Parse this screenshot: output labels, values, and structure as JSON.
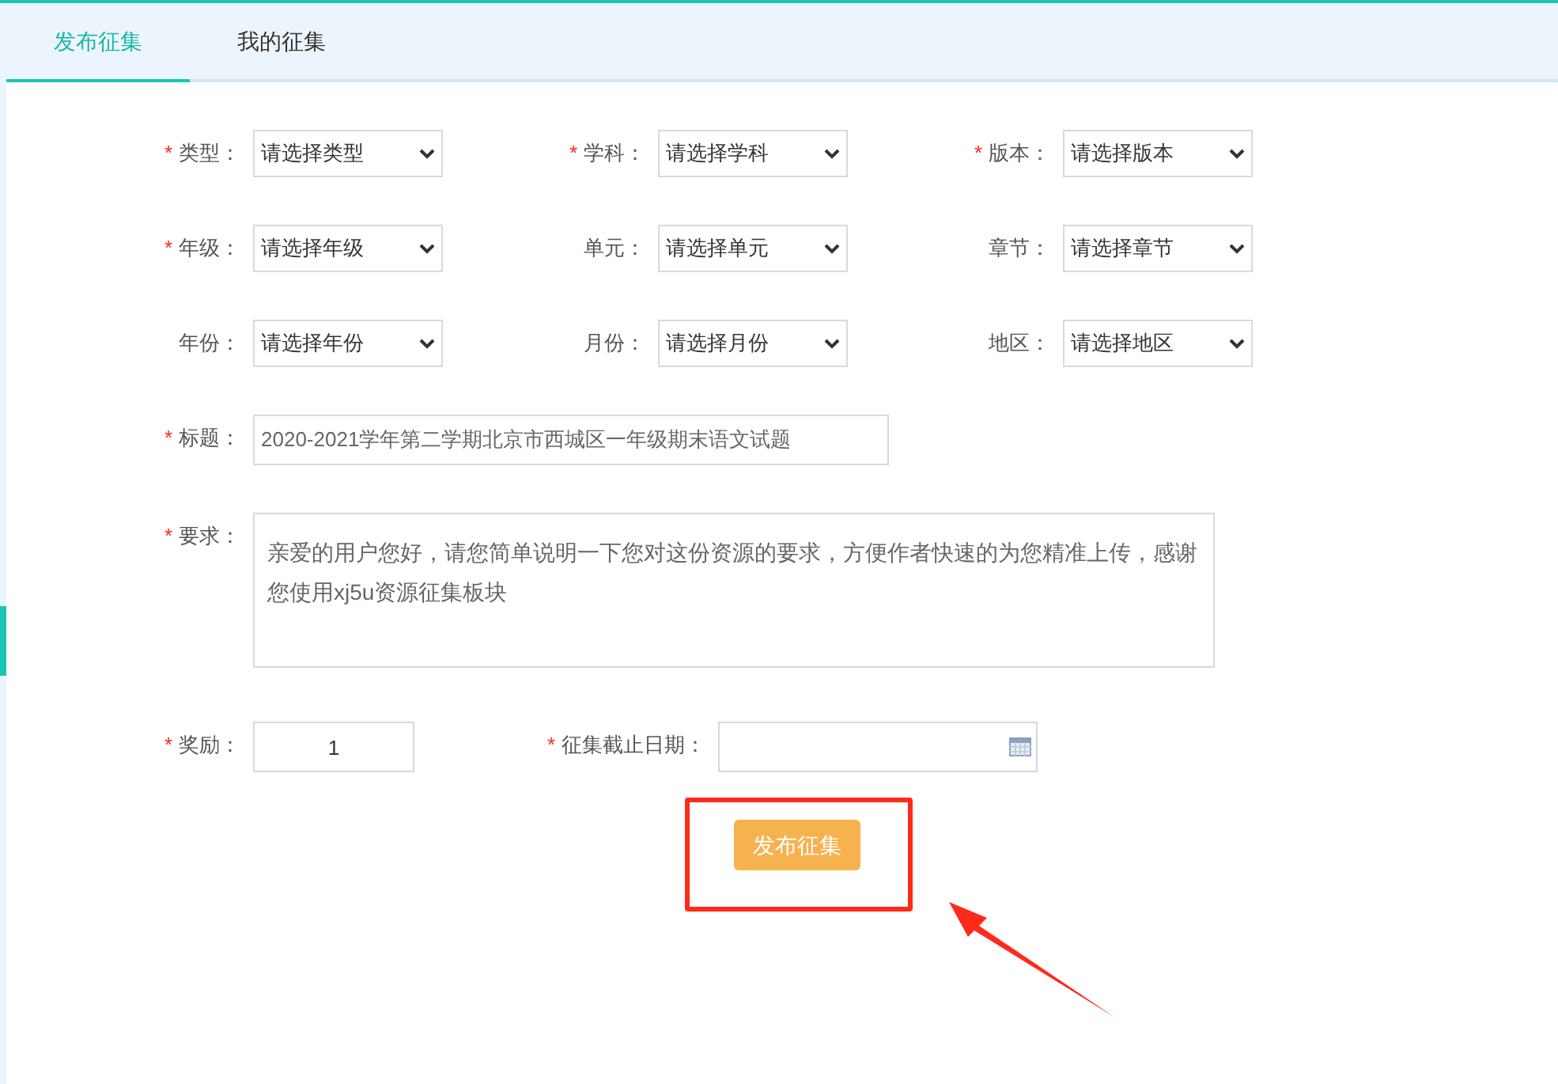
{
  "tabs": [
    {
      "label": "发布征集",
      "selected": true
    },
    {
      "label": "我的征集",
      "selected": false
    }
  ],
  "select_rows": [
    [
      {
        "marker": "*",
        "label": "类型：",
        "placeholder": "请选择类型"
      },
      {
        "marker": "*",
        "label": "学科：",
        "placeholder": "请选择学科"
      },
      {
        "marker": "*",
        "label": "版本：",
        "placeholder": "请选择版本"
      }
    ],
    [
      {
        "marker": "*",
        "label": "年级：",
        "placeholder": "请选择年级"
      },
      {
        "label": "单元：",
        "placeholder": "请选择单元"
      },
      {
        "label": "章节：",
        "placeholder": "请选择章节"
      }
    ],
    [
      {
        "label": "年份：",
        "placeholder": "请选择年份"
      },
      {
        "label": "月份：",
        "placeholder": "请选择月份"
      },
      {
        "label": "地区：",
        "placeholder": "请选择地区"
      }
    ]
  ],
  "title_field": {
    "marker": "*",
    "label": "标题：",
    "value": "2020-2021学年第二学期北京市西城区一年级期末语文试题"
  },
  "requirement_field": {
    "marker": "*",
    "label": "要求：",
    "value": "亲爱的用户您好，请您简单说明一下您对这份资源的要求，方便作者快速的为您精准上传，感谢您使用xj5u资源征集板块"
  },
  "reward_field": {
    "marker": "*",
    "label": "奖励：",
    "value": "1"
  },
  "deadline_field": {
    "marker": "*",
    "label": "征集截止日期："
  },
  "submit_button": "发布征集"
}
